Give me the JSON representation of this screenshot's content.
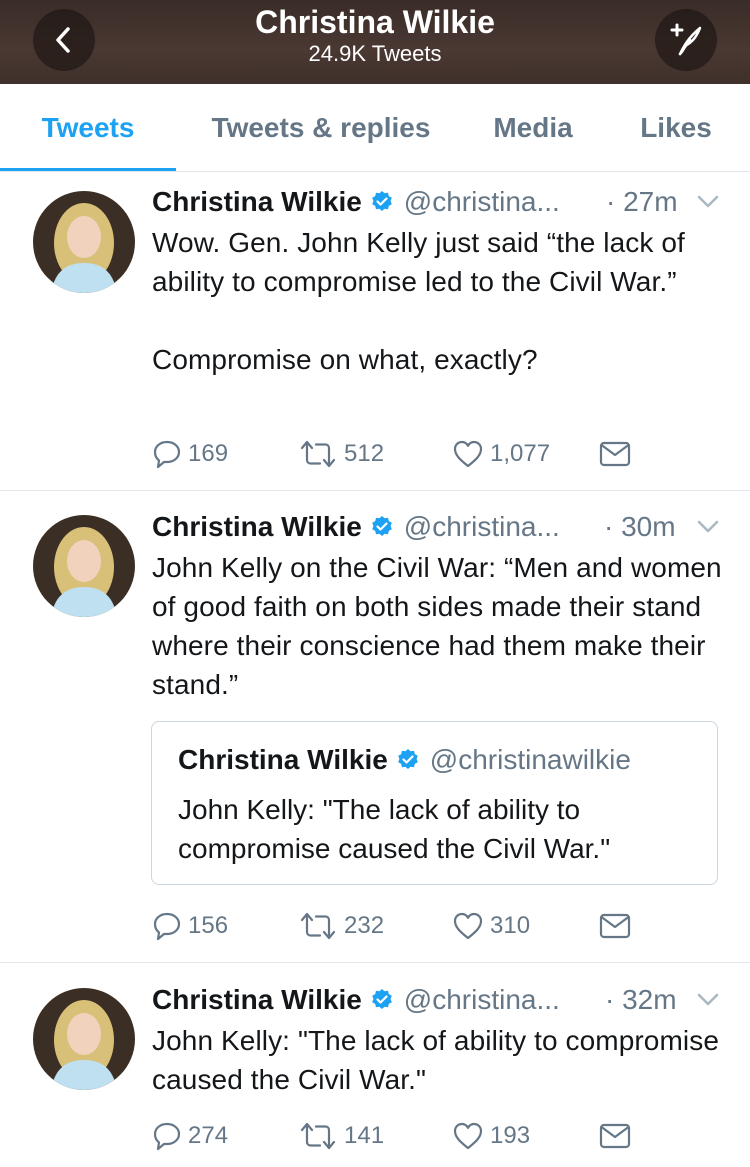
{
  "header": {
    "title": "Christina Wilkie",
    "subtitle": "24.9K Tweets",
    "back_icon": "chevron-left-icon",
    "compose_icon": "compose-tweet-icon"
  },
  "tabs": [
    {
      "label": "Tweets",
      "active": true
    },
    {
      "label": "Tweets & replies",
      "active": false
    },
    {
      "label": "Media",
      "active": false
    },
    {
      "label": "Likes",
      "active": false
    }
  ],
  "colors": {
    "accent": "#1da1f2",
    "text": "#14171a",
    "muted": "#657786"
  },
  "tweets": [
    {
      "name": "Christina Wilkie",
      "handle": "@christina...",
      "time": "· 27m",
      "text": "Wow. Gen. John Kelly just said “the lack of ability to compromise led to the Civil War.”\n\nCompromise on what, exactly?",
      "replies": "169",
      "retweets": "512",
      "likes": "1,077"
    },
    {
      "name": "Christina Wilkie",
      "handle": "@christina...",
      "time": "· 30m",
      "text": "John Kelly on the Civil War: “Men and women of good faith on both sides made their stand where their conscience had them make their stand.”",
      "quote": {
        "name": "Christina Wilkie",
        "handle": "@christinawilkie",
        "text": "John Kelly: \"The lack of ability to compromise caused the Civil War.\""
      },
      "replies": "156",
      "retweets": "232",
      "likes": "310"
    },
    {
      "name": "Christina Wilkie",
      "handle": "@christina...",
      "time": "· 32m",
      "text": "John Kelly: \"The lack of ability to compromise caused the Civil War.\"",
      "replies": "274",
      "retweets": "141",
      "likes": "193"
    }
  ]
}
